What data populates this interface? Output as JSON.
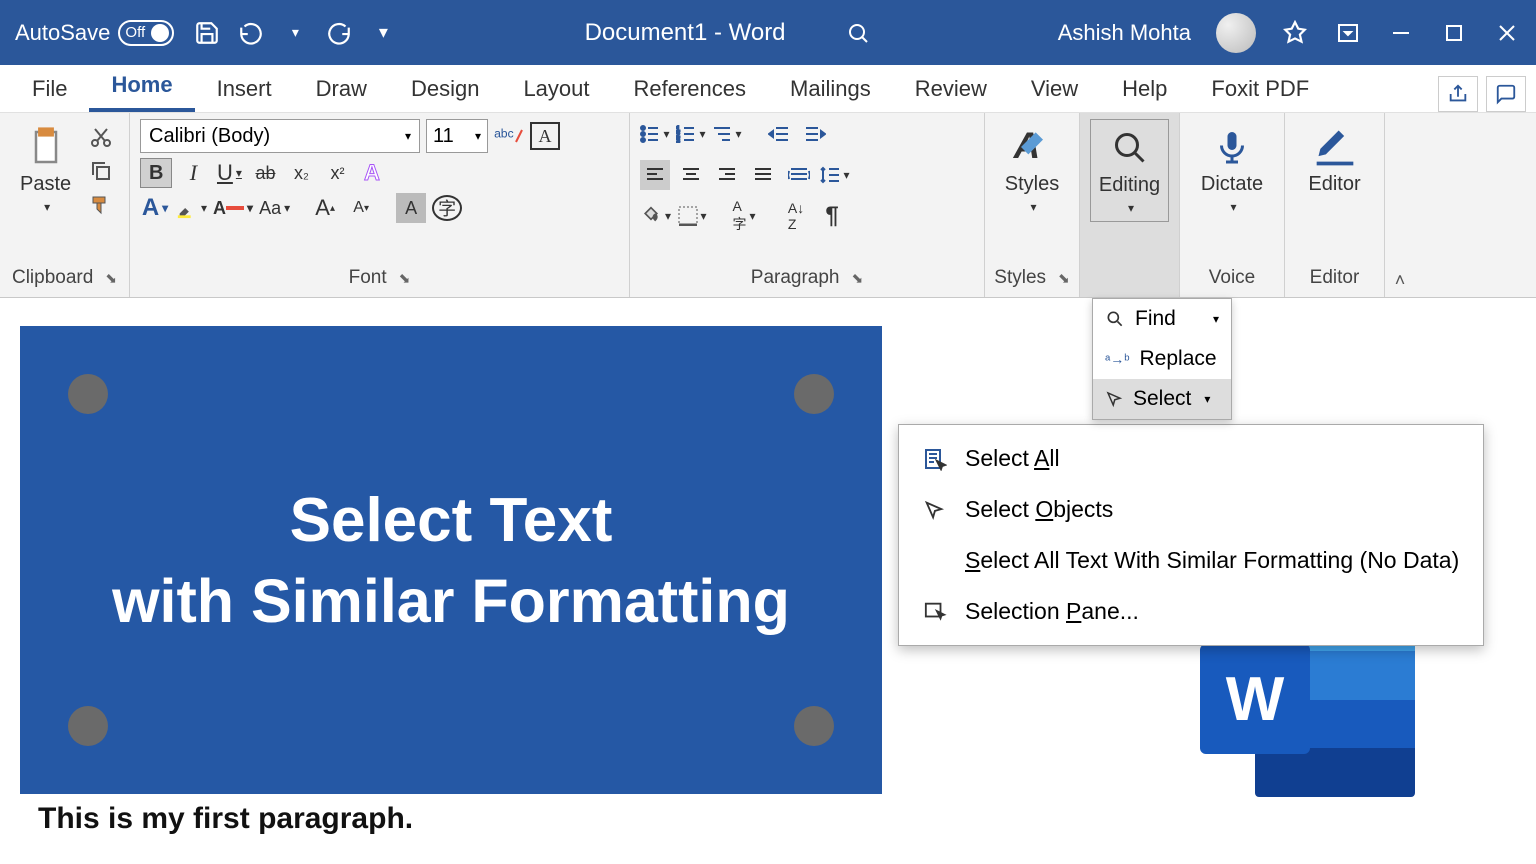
{
  "titlebar": {
    "autosave_label": "AutoSave",
    "autosave_state": "Off",
    "document_title": "Document1 - Word",
    "user_name": "Ashish Mohta"
  },
  "tabs": {
    "items": [
      "File",
      "Home",
      "Insert",
      "Draw",
      "Design",
      "Layout",
      "References",
      "Mailings",
      "Review",
      "View",
      "Help",
      "Foxit PDF"
    ],
    "active": "Home"
  },
  "ribbon": {
    "clipboard": {
      "paste": "Paste",
      "label": "Clipboard"
    },
    "font": {
      "name": "Calibri (Body)",
      "size": "11",
      "label": "Font",
      "bold": "B",
      "italic": "I",
      "underline": "U",
      "text_effects": "A"
    },
    "paragraph": {
      "label": "Paragraph"
    },
    "styles": {
      "button": "Styles",
      "label": "Styles"
    },
    "editing": {
      "button": "Editing"
    },
    "voice": {
      "button": "Dictate",
      "label": "Voice"
    },
    "editor": {
      "button": "Editor",
      "label": "Editor"
    }
  },
  "editing_menu": {
    "find": "Find",
    "replace": "Replace",
    "select": "Select"
  },
  "select_menu": {
    "select_all_pre": "Select ",
    "select_all_key": "A",
    "select_all_post": "ll",
    "select_objects_pre": "Select ",
    "select_objects_key": "O",
    "select_objects_post": "bjects",
    "similar_pre": "",
    "similar_key": "S",
    "similar_post": "elect All Text With Similar Formatting (No Data)",
    "pane_pre": "Selection ",
    "pane_key": "P",
    "pane_post": "ane..."
  },
  "document": {
    "line1": "Select Text",
    "line2": "with Similar Formatting",
    "paragraph": "This is my first paragraph."
  },
  "word_logo": "W"
}
